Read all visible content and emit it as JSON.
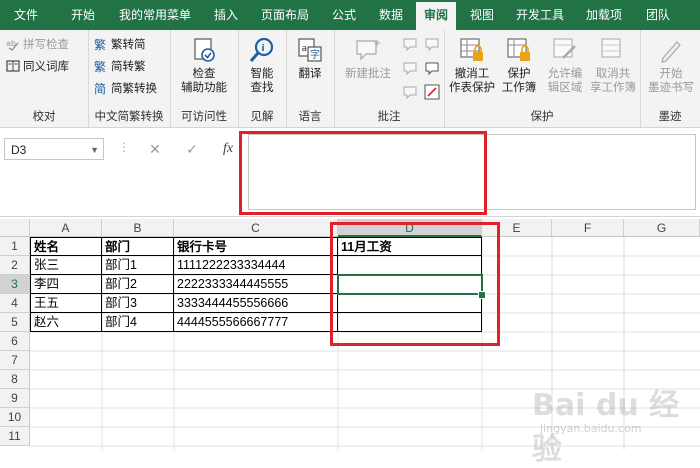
{
  "tabs": [
    "文件",
    "开始",
    "我的常用菜单",
    "插入",
    "页面布局",
    "公式",
    "数据",
    "审阅",
    "视图",
    "开发工具",
    "加载项",
    "团队"
  ],
  "active_tab": "审阅",
  "colors": {
    "brand": "#217346",
    "highlight": "#e0212c"
  },
  "ribbon": {
    "proof": {
      "spell": "拼写检查",
      "thesaurus": "同义词库",
      "label": "校对"
    },
    "chinese": {
      "to_trad": "繁转简",
      "to_simp": "简转繁",
      "convert": "简繁转换",
      "label": "中文简繁转换"
    },
    "access": {
      "check_line1": "检查",
      "check_line2": "辅助功能",
      "label": "可访问性"
    },
    "insights": {
      "line1": "智能",
      "line2": "查找",
      "label": "见解"
    },
    "language": {
      "translate": "翻译",
      "label": "语言"
    },
    "comments": {
      "new": "新建批注",
      "label": "批注"
    },
    "protect": {
      "unprotect_line1": "撤消工",
      "unprotect_line2": "作表保护",
      "protect_line1": "保护",
      "protect_line2": "工作簿",
      "allow_line1": "允许编",
      "allow_line2": "辑区域",
      "unshare_line1": "取消共",
      "unshare_line2": "享工作簿",
      "label": "保护"
    },
    "ink": {
      "line1": "开始",
      "line2": "墨迹书写",
      "label": "墨迹"
    }
  },
  "formula_bar": {
    "name_box": "D3",
    "cancel": "✕",
    "enter": "✓",
    "fx": "fx",
    "value": ""
  },
  "columns": [
    "A",
    "B",
    "C",
    "D",
    "E",
    "F",
    "G"
  ],
  "selected_column": "D",
  "rows": [
    "1",
    "2",
    "3",
    "4",
    "5",
    "6",
    "7",
    "8",
    "9",
    "10",
    "11"
  ],
  "selected_row": "3",
  "cells": {
    "header": [
      "姓名",
      "部门",
      "银行卡号",
      "11月工资"
    ],
    "r2": [
      "张三",
      "部门1",
      "1111222233334444",
      ""
    ],
    "r3": [
      "李四",
      "部门2",
      "2222333344445555",
      ""
    ],
    "r4": [
      "王五",
      "部门3",
      "3333444455556666",
      ""
    ],
    "r5": [
      "赵六",
      "部门4",
      "4444555566667777",
      ""
    ]
  },
  "watermark": {
    "main": "Bai du 经验",
    "sub": "jingyan.baidu.com"
  }
}
